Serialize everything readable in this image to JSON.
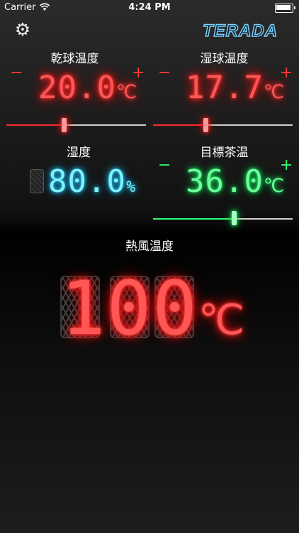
{
  "status_bar": {
    "carrier": "Carrier",
    "time": "4:24 PM"
  },
  "header": {
    "logo_text": "TERADA",
    "settings_icon": "gear-icon"
  },
  "dry_bulb": {
    "label": "乾球温度",
    "minus": "−",
    "plus": "+",
    "value": "20.0",
    "unit": "℃",
    "slider_level": 0.41
  },
  "wet_bulb": {
    "label": "湿球温度",
    "minus": "−",
    "plus": "+",
    "value": "17.7",
    "unit": "℃",
    "slider_level": 0.37
  },
  "humidity": {
    "label": "湿度",
    "value": "80.0",
    "unit": "%"
  },
  "target_tea_temp": {
    "label": "目標茶温",
    "minus": "−",
    "plus": "+",
    "value": "36.0",
    "unit": "℃",
    "slider_level": 0.58
  },
  "hot_air_temp": {
    "label": "熱風温度",
    "value": "100",
    "unit": "℃"
  },
  "colors": {
    "red_glow": "#ff3a3a",
    "cyan_glow": "#2ad4ff",
    "green_glow": "#1dff65",
    "slider_track": "#d0d0d0"
  }
}
